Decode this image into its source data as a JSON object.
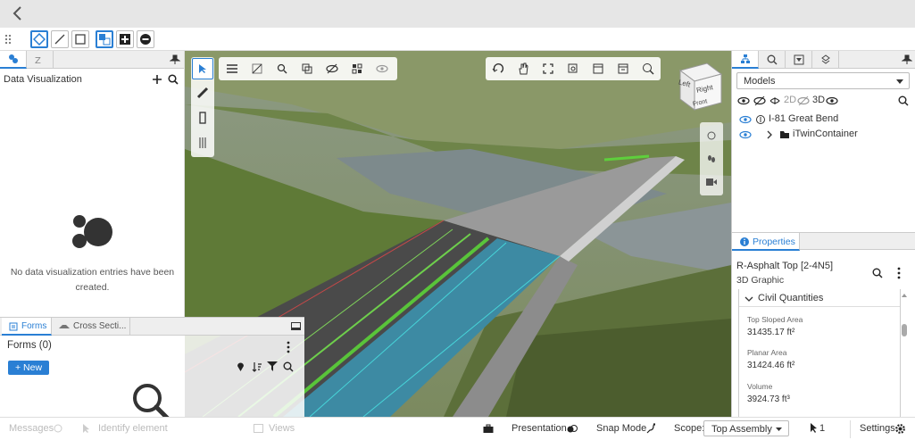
{
  "header": {
    "back_icon": "chevron-left-icon"
  },
  "left_panel": {
    "title": "Data Visualization",
    "empty_message_line1": "No data visualization entries have been",
    "empty_message_line2": "created."
  },
  "forms": {
    "tab_forms": "Forms",
    "tab_cross": "Cross Secti...",
    "title": "Forms (0)",
    "new_button": "+ New"
  },
  "status": {
    "messages": "Messages",
    "identify": "Identify element",
    "views": "Views",
    "presentation": "Presentation",
    "snap_mode": "Snap Mode",
    "scope_label": "Scope:",
    "scope_value": "Top Assembly",
    "selection_count": "1",
    "settings": "Settings"
  },
  "models": {
    "dropdown": "Models",
    "toggle_2d": "2D",
    "toggle_3d": "3D",
    "root": "I-81 Great Bend",
    "child": "iTwinContainer"
  },
  "properties": {
    "tab": "Properties",
    "element_name": "R-Asphalt Top [2-4N5]",
    "element_class": "3D Graphic",
    "section": "Civil Quantities",
    "items": [
      {
        "label": "Top Sloped Area",
        "value": "31435.17 ft²"
      },
      {
        "label": "Planar Area",
        "value": "31424.46 ft²"
      },
      {
        "label": "Volume",
        "value": "3924.73 ft³"
      }
    ]
  },
  "view_cube": {
    "left": "Left",
    "right": "Right",
    "front": "Front"
  }
}
